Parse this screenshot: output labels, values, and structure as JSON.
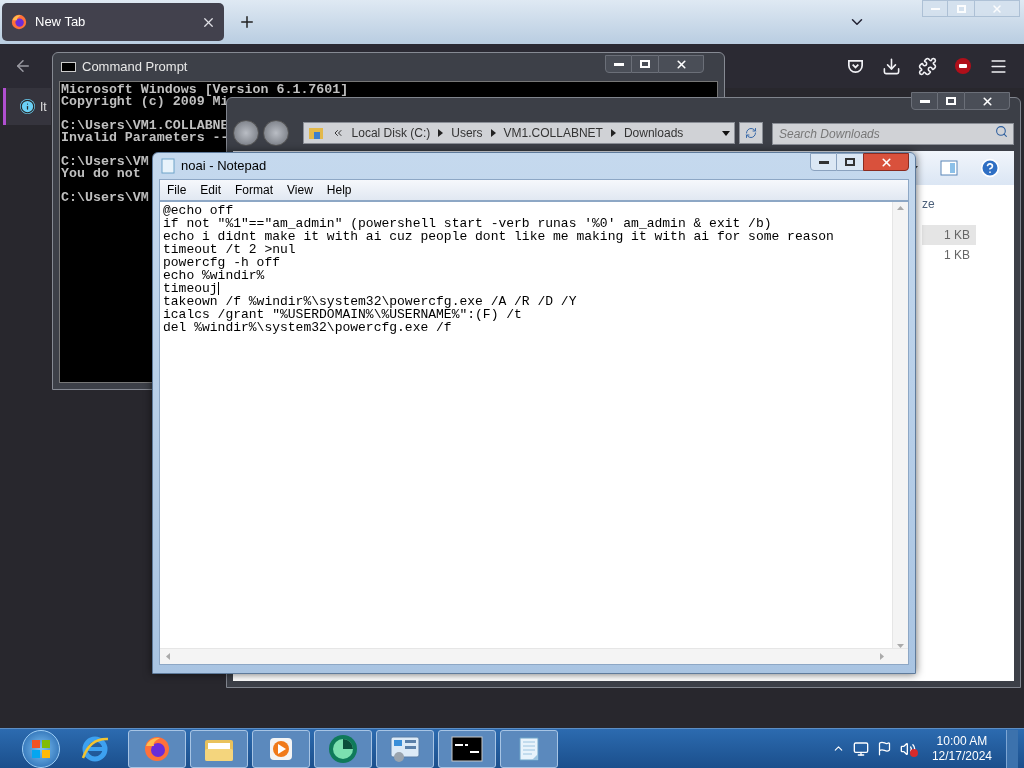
{
  "browser": {
    "tab": {
      "title": "New Tab"
    },
    "sidebar_item": {
      "label": "It"
    }
  },
  "command_prompt": {
    "title": "Command Prompt",
    "blocks": [
      [
        "Microsoft Windows [Version 6.1.7601]",
        "Copyright (c) 2009 Mi"
      ],
      [
        "C:\\Users\\VM1.COLLABNE",
        "Invalid Parameters --"
      ],
      [
        "C:\\Users\\VM",
        "You do not"
      ],
      [
        "C:\\Users\\VM"
      ]
    ]
  },
  "explorer": {
    "breadcrumb": [
      "Local Disk (C:)",
      "Users",
      "VM1.COLLABNET",
      "Downloads"
    ],
    "search": {
      "placeholder": "Search Downloads"
    },
    "column_header": "ze",
    "rows": [
      {
        "size": "1 KB",
        "selected": true
      },
      {
        "size": "1 KB",
        "selected": false
      }
    ]
  },
  "notepad": {
    "title": "noai - Notepad",
    "menu": [
      "File",
      "Edit",
      "Format",
      "View",
      "Help"
    ],
    "lines": [
      {
        "text": "@echo off",
        "caret": false
      },
      {
        "text": "if not \"%1\"==\"am_admin\" (powershell start -verb runas '%0' am_admin & exit /b)",
        "caret": false
      },
      {
        "text": "echo i didnt make it with ai cuz people dont like me making it with ai for some reason",
        "caret": false
      },
      {
        "text": "timeout /t 2 >nul",
        "caret": false
      },
      {
        "text": "powercfg -h off",
        "caret": false
      },
      {
        "text": "echo %windir%",
        "caret": false
      },
      {
        "text": "timeouj",
        "caret": true
      },
      {
        "text": "takeown /f %windir%\\system32\\powercfg.exe /A /R /D /Y",
        "caret": false
      },
      {
        "text": "icalcs /grant \"%USERDOMAIN%\\%USERNAME%\":(F) /t",
        "caret": false
      },
      {
        "text": "del %windir%\\system32\\powercfg.exe /f",
        "caret": false
      }
    ]
  },
  "taskbar": {
    "apps": [
      {
        "kind": "ie",
        "running": false
      },
      {
        "kind": "firefox",
        "running": true
      },
      {
        "kind": "folder",
        "running": true
      },
      {
        "kind": "media",
        "running": true
      },
      {
        "kind": "green-app",
        "running": true
      },
      {
        "kind": "control-panel",
        "running": true
      },
      {
        "kind": "cmd",
        "running": true
      },
      {
        "kind": "notepad",
        "running": true
      }
    ],
    "clock": {
      "time": "10:00 AM",
      "date": "12/17/2024"
    }
  }
}
